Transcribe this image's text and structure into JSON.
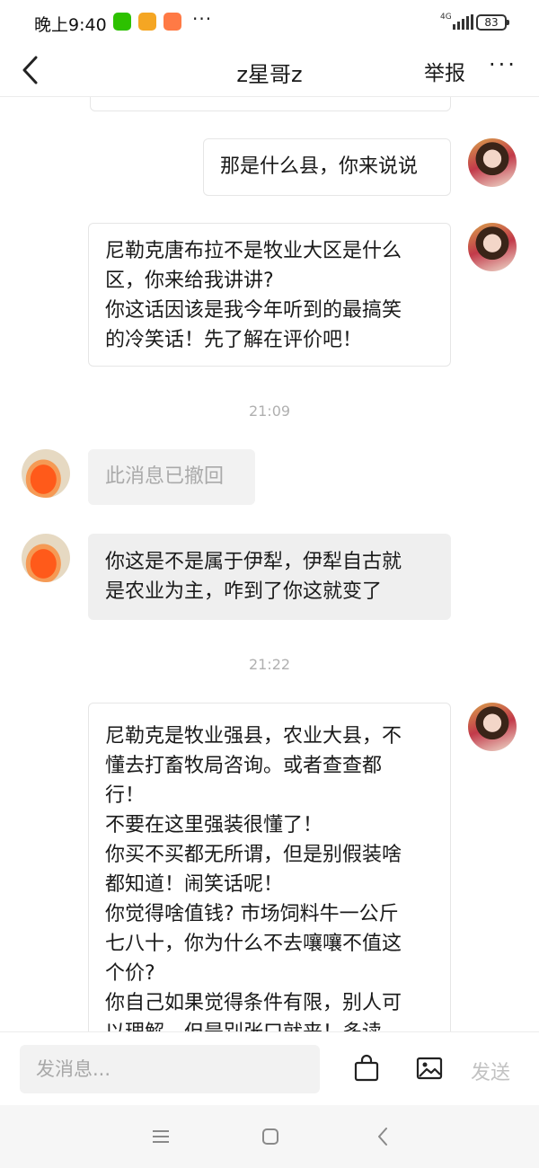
{
  "status_bar": {
    "time": "晚上9:40",
    "dots": "···",
    "network": "4G",
    "battery": "83",
    "app_icons": [
      "wechat-icon",
      "notes-icon",
      "shop-icon"
    ]
  },
  "header": {
    "title": "z星哥z",
    "report_label": "举报",
    "more_label": "···"
  },
  "messages": [
    {
      "from": "user",
      "lines": [
        "那是什么县，你来说说"
      ]
    },
    {
      "from": "user",
      "lines": [
        "尼勒克唐布拉不是牧业大区是什么",
        "区，你来给我讲讲?",
        "你这话因该是我今年听到的最搞笑",
        "的冷笑话！先了解在评价吧！"
      ]
    },
    {
      "timestamp": "21:09"
    },
    {
      "from": "other",
      "recalled": true,
      "lines": [
        "此消息已撤回"
      ]
    },
    {
      "from": "other",
      "lines": [
        "你这是不是属于伊犁，伊犁自古就",
        "是农业为主，咋到了你这就变了"
      ]
    },
    {
      "timestamp": "21:22"
    },
    {
      "from": "user",
      "lines": [
        "尼勒克是牧业强县，农业大县，不",
        "懂去打畜牧局咨询。或者查查都",
        "行！",
        "不要在这里强装很懂了！",
        "你买不买都无所谓，但是别假装啥",
        "都知道！闹笑话呢！",
        "你觉得啥值钱? 市场饲料牛一公斤",
        "七八十，你为什么不去嚷嚷不值这",
        "个价?",
        "你自己如果觉得条件有限，别人可",
        "以理解，但是别张口就来！多读"
      ]
    }
  ],
  "input_bar": {
    "placeholder": "发消息...",
    "send_label": "发送"
  },
  "colors": {
    "accent_gray": "#efefef",
    "border": "#e6e6e6",
    "muted_text": "#aaaaaa",
    "timestamp": "#b0b0b0"
  }
}
